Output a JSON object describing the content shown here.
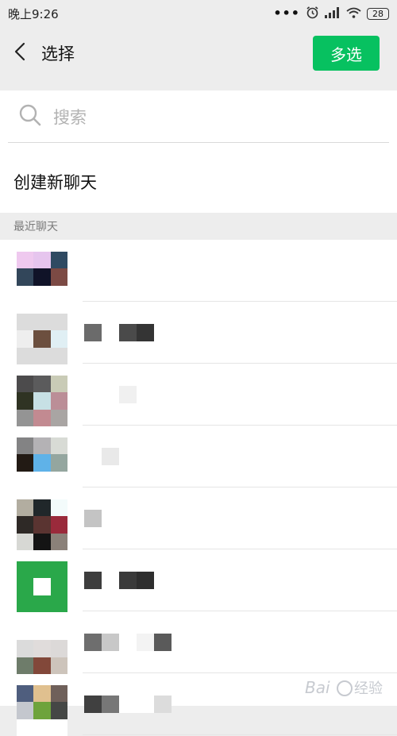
{
  "status": {
    "time": "晚上9:26",
    "battery": "28",
    "icons": [
      "more-dots-icon",
      "alarm-icon",
      "signal-icon",
      "wifi-icon",
      "battery-icon"
    ]
  },
  "header": {
    "back_icon": "chevron-left-icon",
    "title": "选择",
    "multi_select_label": "多选",
    "accent": "#07c160"
  },
  "search": {
    "icon": "search-icon",
    "placeholder": "搜索"
  },
  "new_chat_label": "创建新聊天",
  "recent_section_label": "最近聊天",
  "recent_chats": [
    {
      "avatar_colors": [
        "#efc9ef",
        "#e6c5ee",
        "#2f4a62",
        "#32465a",
        "#101328",
        "#7c4a44",
        "#ffffff",
        "#ffffff",
        "#ffffff"
      ],
      "name_blocks": []
    },
    {
      "avatar_colors": [
        "#dcdcdc",
        "#dcdcdc",
        "#dcdcdc",
        "#eeeeee",
        "#6c4f3f",
        "#e0eff4",
        "#dcdcdc",
        "#dcdcdc",
        "#dcdcdc"
      ],
      "name_blocks": [
        "#6b6b6b",
        "#ffffff",
        "#4a4a4a",
        "#343434"
      ]
    },
    {
      "avatar_colors": [
        "#4c4b4c",
        "#5b5b5c",
        "#c9cbb6",
        "#2f3323",
        "#c7e0e5",
        "#bb8e97",
        "#949494",
        "#c28a91",
        "#a9a5a3"
      ],
      "name_blocks": [
        "#ffffff",
        "#ffffff",
        "#f0f0f0"
      ]
    },
    {
      "avatar_colors": [
        "#838384",
        "#b4b2b5",
        "#d8dbd5",
        "#221a14",
        "#5fb2e8",
        "#94a69f",
        "#ffffff",
        "#ffffff",
        "#ffffff"
      ],
      "name_blocks": [
        "#ffffff",
        "#e9e9e9"
      ]
    },
    {
      "avatar_colors": [
        "#b2ada0",
        "#20272a",
        "#f3fbfb",
        "#2e2926",
        "#5a3431",
        "#9a2a3b",
        "#d7d8d4",
        "#141414",
        "#8b8179"
      ],
      "name_blocks": [
        "#c4c4c4"
      ]
    },
    {
      "avatar_colors": [
        "#2aa84a",
        "#2aa84a",
        "#2aa84a",
        "#2aa84a",
        "#ffffff",
        "#2aa84a",
        "#2aa84a",
        "#2aa84a",
        "#2aa84a"
      ],
      "name_blocks": [
        "#3d3d3d",
        "#ffffff",
        "#3a3a3a",
        "#2e2e2e"
      ]
    },
    {
      "avatar_colors": [
        "#ffffff",
        "#ffffff",
        "#ffffff",
        "#dbdbdb",
        "#e0dcdb",
        "#dcd9d8",
        "#6e7c6a",
        "#82483a",
        "#cdc4bb"
      ],
      "name_blocks": [
        "#6e6e6e",
        "#c8c8c8",
        "#ffffff",
        "#f3f3f3",
        "#5a5a5a"
      ]
    },
    {
      "avatar_colors": [
        "#4f5e7e",
        "#e0c08f",
        "#6f605a",
        "#c4c7ce",
        "#6ea33c",
        "#454745",
        "#ffffff",
        "#ffffff",
        "#ffffff"
      ],
      "name_blocks": [
        "#404040",
        "#777777",
        "#ffffff",
        "#ffffff",
        "#dcdcdc"
      ]
    }
  ],
  "watermark_text": "Bai经验"
}
